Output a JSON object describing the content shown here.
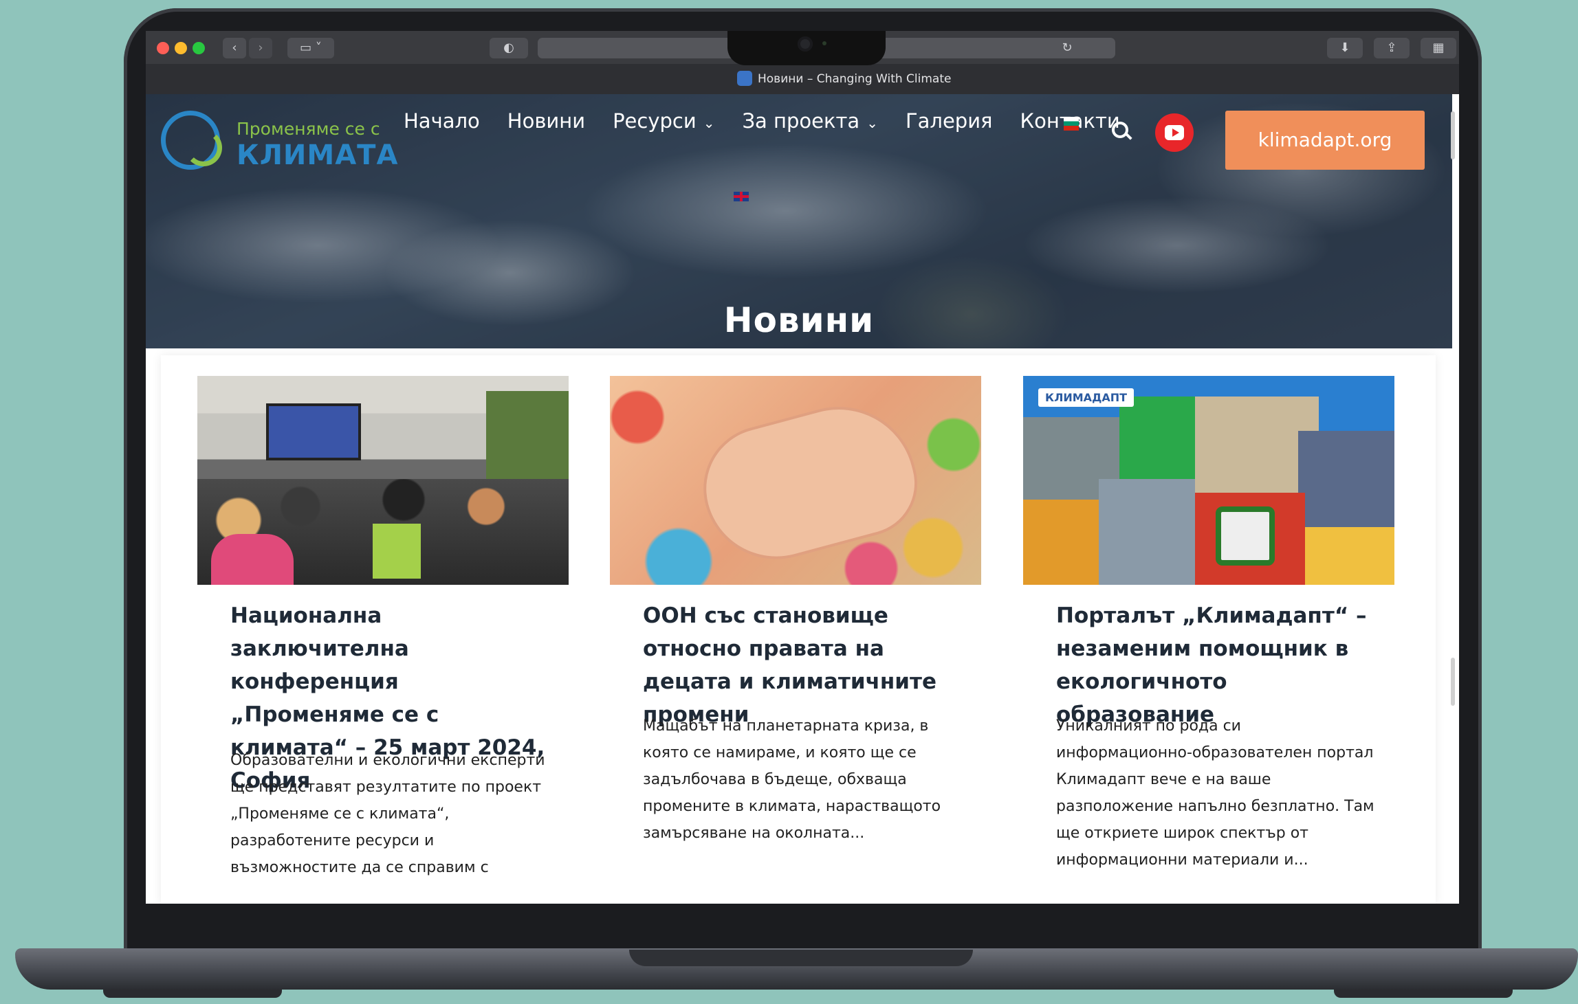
{
  "browser": {
    "tab_title": "Новини – Changing With Climate"
  },
  "header": {
    "logo_line1": "Променяме се с",
    "logo_line2": "КЛИМАТА",
    "nav": [
      {
        "label": "Начало"
      },
      {
        "label": "Новини"
      },
      {
        "label": "Ресурси",
        "has_dropdown": true
      },
      {
        "label": "За проекта",
        "has_dropdown": true
      },
      {
        "label": "Галерия"
      },
      {
        "label": "Контакти"
      }
    ],
    "languages": [
      "bg-flag-icon",
      "uk-flag-icon"
    ],
    "cta_label": "klimadapt.org",
    "icons": {
      "search": "search-icon",
      "youtube": "youtube-icon"
    }
  },
  "hero": {
    "title": "Новини"
  },
  "cards": [
    {
      "title": "Национална заключителна конференция „Променяме се с климата“ – 25 март 2024, София",
      "excerpt": "Образователни и екологични експерти ще представят резултатите по проект „Променяме се с климата“, разработените ресурси и възможностите да се справим с"
    },
    {
      "title": "ООН със становище относно правата на децата и климатичните промени",
      "excerpt": "Мащабът на планетарната криза, в която се намираме, и която ще се задълбочава в бъдеще, обхваща промените в климата, нарастващото замърсяване на околната..."
    },
    {
      "title": "Порталът „Климадапт“ – незаменим помощник в екологичното образование",
      "excerpt": "Уникалният по рода си информационно-образователен портал Климадапт вече е на ваше разположение напълно безплатно. Там ще откриете широк спектър от информационни материали и...",
      "image_label": "КЛИМАДАПТ"
    }
  ],
  "colors": {
    "accent_orange": "#f08f5a",
    "logo_green": "#8bc34a",
    "logo_blue": "#2a86c6",
    "youtube_red": "#e8262a"
  }
}
